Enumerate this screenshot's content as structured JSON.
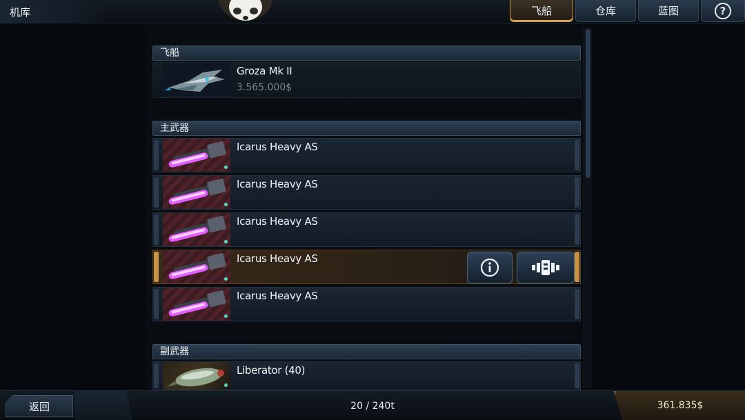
{
  "app": {
    "title": "机库"
  },
  "tabs": [
    {
      "label": "飞船",
      "active": true
    },
    {
      "label": "仓库",
      "active": false
    },
    {
      "label": "蓝图",
      "active": false
    },
    {
      "label": "?",
      "icon": "help-icon",
      "active": false
    }
  ],
  "sections": {
    "ship": {
      "header": "飞船",
      "items": [
        {
          "name": "Groza Mk II",
          "price": "3.565.000$",
          "icon": "spaceship-icon"
        }
      ]
    },
    "primary": {
      "header": "主武器",
      "items": [
        {
          "name": "Icarus Heavy AS",
          "icon": "laser-cannon-icon",
          "selected": false
        },
        {
          "name": "Icarus Heavy AS",
          "icon": "laser-cannon-icon",
          "selected": false
        },
        {
          "name": "Icarus Heavy AS",
          "icon": "laser-cannon-icon",
          "selected": false
        },
        {
          "name": "Icarus Heavy AS",
          "icon": "laser-cannon-icon",
          "selected": true
        },
        {
          "name": "Icarus Heavy AS",
          "icon": "laser-cannon-icon",
          "selected": false
        }
      ]
    },
    "secondary": {
      "header": "副武器",
      "items": [
        {
          "name": "Liberator (40)",
          "icon": "missile-icon"
        }
      ]
    }
  },
  "actions": {
    "info_icon": "info-icon",
    "equip_icon": "equip-module-icon"
  },
  "footer": {
    "back_label": "返回",
    "capacity": "20 / 240t",
    "money": "361.835$"
  },
  "colors": {
    "accent": "#e0a84b",
    "status_dot": "#4fe0c4",
    "weapon_glow": "#e25cff"
  }
}
